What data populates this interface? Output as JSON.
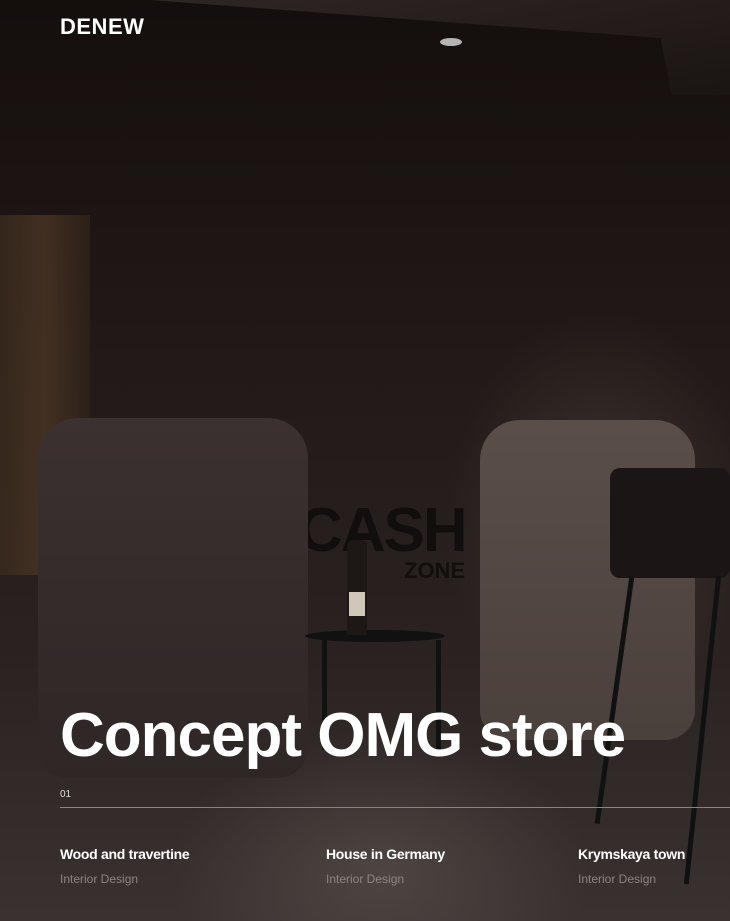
{
  "header": {
    "logo": "DENEW"
  },
  "hero": {
    "title": "Concept OMG store",
    "index": "01",
    "sign_main": "CASH",
    "sign_sub": "ZONE"
  },
  "projects": [
    {
      "title": "Wood and travertine",
      "category": "Interior Design"
    },
    {
      "title": "House in Germany",
      "category": "Interior Design"
    },
    {
      "title": "Krymskaya town",
      "category": "Interior Design"
    }
  ]
}
